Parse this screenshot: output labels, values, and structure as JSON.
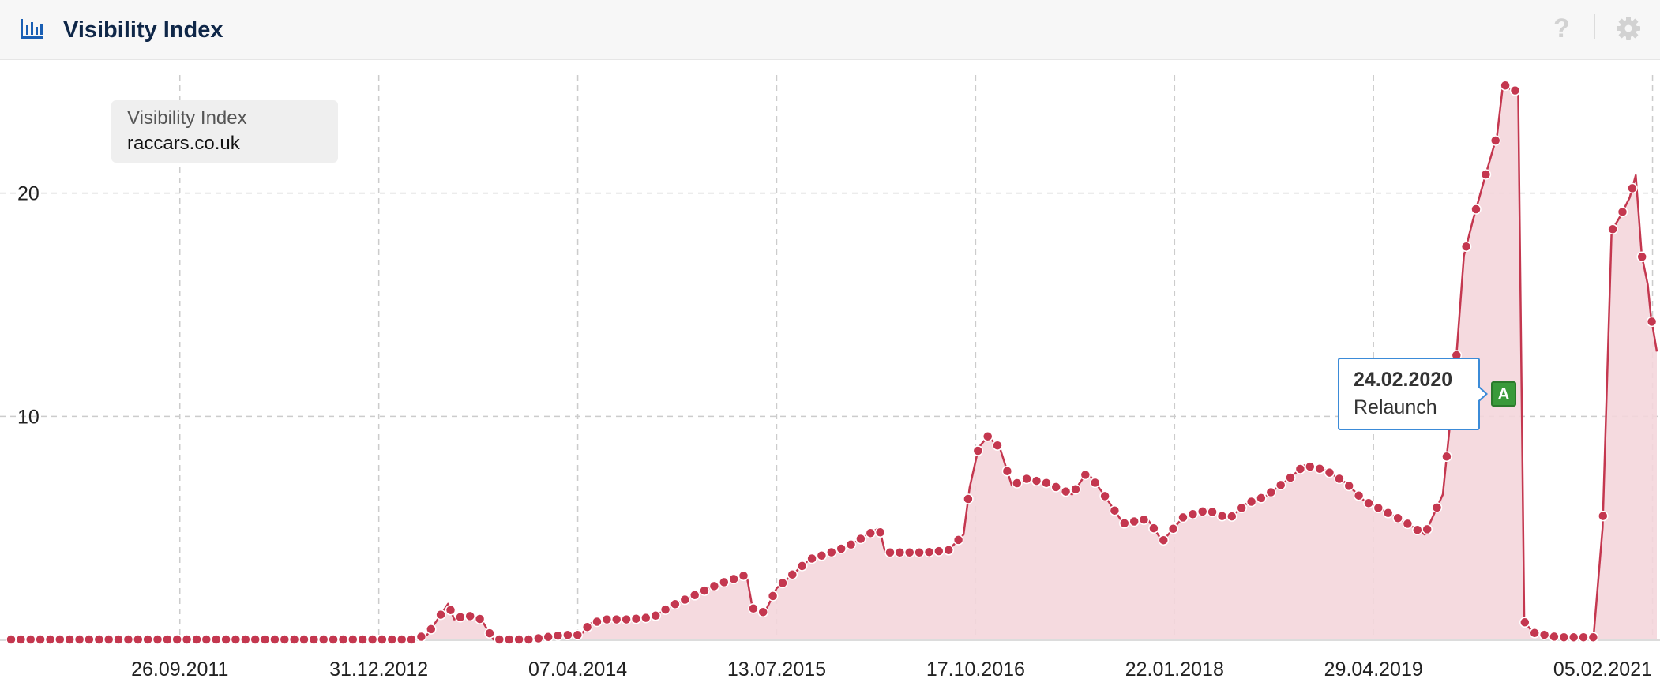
{
  "header": {
    "title": "Visibility Index",
    "help_label": "?"
  },
  "legend": {
    "title": "Visibility Index",
    "domain": "raccars.co.uk"
  },
  "annotation": {
    "date": "24.02.2020",
    "event": "Relaunch",
    "marker_label": "A"
  },
  "colors": {
    "line": "#c4374f",
    "fill": "#f4d6dc",
    "accent": "#1a5fb4",
    "marker": "#3a9a3a",
    "tooltip_border": "#3b8bd8"
  },
  "chart_data": {
    "type": "area",
    "x_ticks": [
      "26.09.2011",
      "31.12.2012",
      "07.04.2014",
      "13.07.2015",
      "17.10.2016",
      "22.01.2018",
      "29.04.2019",
      "05.02.2021"
    ],
    "y_ticks": [
      10,
      20
    ],
    "ylim": [
      0,
      25.4
    ],
    "xlim": [
      "2010-08-30",
      "2021-02-15"
    ],
    "grid": true,
    "legend_position": "top-left",
    "series": [
      {
        "points": [
          [
            "2010-08-30",
            0.0
          ],
          [
            "2010-12-01",
            0.0
          ],
          [
            "2011-06-01",
            0.0
          ],
          [
            "2011-12-01",
            0.0
          ],
          [
            "2012-06-01",
            0.0
          ],
          [
            "2012-12-01",
            0.0
          ],
          [
            "2013-03-18",
            0.0
          ],
          [
            "2013-04-22",
            0.2
          ],
          [
            "2013-05-13",
            0.8
          ],
          [
            "2013-06-10",
            1.6
          ],
          [
            "2013-06-24",
            0.9
          ],
          [
            "2013-07-22",
            1.1
          ],
          [
            "2013-08-26",
            0.9
          ],
          [
            "2013-09-23",
            0.0
          ],
          [
            "2013-12-16",
            0.0
          ],
          [
            "2014-03-03",
            0.2
          ],
          [
            "2014-04-14",
            0.2
          ],
          [
            "2014-05-05",
            0.7
          ],
          [
            "2014-06-09",
            0.9
          ],
          [
            "2014-08-04",
            0.9
          ],
          [
            "2014-09-29",
            1.0
          ],
          [
            "2014-11-10",
            1.5
          ],
          [
            "2015-01-05",
            2.0
          ],
          [
            "2015-03-02",
            2.5
          ],
          [
            "2015-05-04",
            2.9
          ],
          [
            "2015-05-18",
            1.4
          ],
          [
            "2015-06-15",
            1.2
          ],
          [
            "2015-07-13",
            2.3
          ],
          [
            "2015-08-24",
            3.0
          ],
          [
            "2015-09-28",
            3.6
          ],
          [
            "2015-11-02",
            3.8
          ],
          [
            "2015-12-28",
            4.2
          ],
          [
            "2016-03-07",
            5.0
          ],
          [
            "2016-03-21",
            3.9
          ],
          [
            "2016-04-25",
            3.9
          ],
          [
            "2016-06-20",
            3.9
          ],
          [
            "2016-08-15",
            4.0
          ],
          [
            "2016-09-19",
            4.7
          ],
          [
            "2016-10-03",
            6.8
          ],
          [
            "2016-10-24",
            8.6
          ],
          [
            "2016-11-14",
            9.1
          ],
          [
            "2016-12-12",
            8.6
          ],
          [
            "2017-01-09",
            6.9
          ],
          [
            "2017-02-13",
            7.2
          ],
          [
            "2017-04-03",
            7.0
          ],
          [
            "2017-05-29",
            6.5
          ],
          [
            "2017-07-03",
            7.5
          ],
          [
            "2017-08-07",
            6.6
          ],
          [
            "2017-09-25",
            5.2
          ],
          [
            "2017-11-20",
            5.4
          ],
          [
            "2017-12-25",
            4.4
          ],
          [
            "2018-02-12",
            5.5
          ],
          [
            "2018-04-09",
            5.8
          ],
          [
            "2018-05-28",
            5.4
          ],
          [
            "2018-07-09",
            6.1
          ],
          [
            "2018-08-20",
            6.4
          ],
          [
            "2018-10-15",
            7.2
          ],
          [
            "2018-11-19",
            7.8
          ],
          [
            "2019-01-07",
            7.6
          ],
          [
            "2019-02-25",
            7.0
          ],
          [
            "2019-04-08",
            6.2
          ],
          [
            "2019-05-20",
            5.8
          ],
          [
            "2019-07-08",
            5.3
          ],
          [
            "2019-08-26",
            4.7
          ],
          [
            "2019-10-07",
            6.5
          ],
          [
            "2019-11-04",
            11.8
          ],
          [
            "2019-11-25",
            17.2
          ],
          [
            "2019-12-16",
            18.8
          ],
          [
            "2020-01-20",
            21.2
          ],
          [
            "2020-02-10",
            22.6
          ],
          [
            "2020-02-24",
            24.9
          ],
          [
            "2020-03-16",
            24.6
          ],
          [
            "2020-03-30",
            24.6
          ],
          [
            "2020-04-13",
            0.8
          ],
          [
            "2020-05-04",
            0.3
          ],
          [
            "2020-06-29",
            0.1
          ],
          [
            "2020-08-24",
            0.1
          ],
          [
            "2020-09-21",
            0.1
          ],
          [
            "2020-10-12",
            5.0
          ],
          [
            "2020-11-02",
            18.3
          ],
          [
            "2020-11-23",
            19.0
          ],
          [
            "2020-12-14",
            19.8
          ],
          [
            "2020-12-28",
            20.8
          ],
          [
            "2021-01-11",
            17.2
          ],
          [
            "2021-01-25",
            15.9
          ],
          [
            "2021-02-01",
            14.5
          ],
          [
            "2021-02-15",
            12.9
          ]
        ]
      }
    ]
  }
}
